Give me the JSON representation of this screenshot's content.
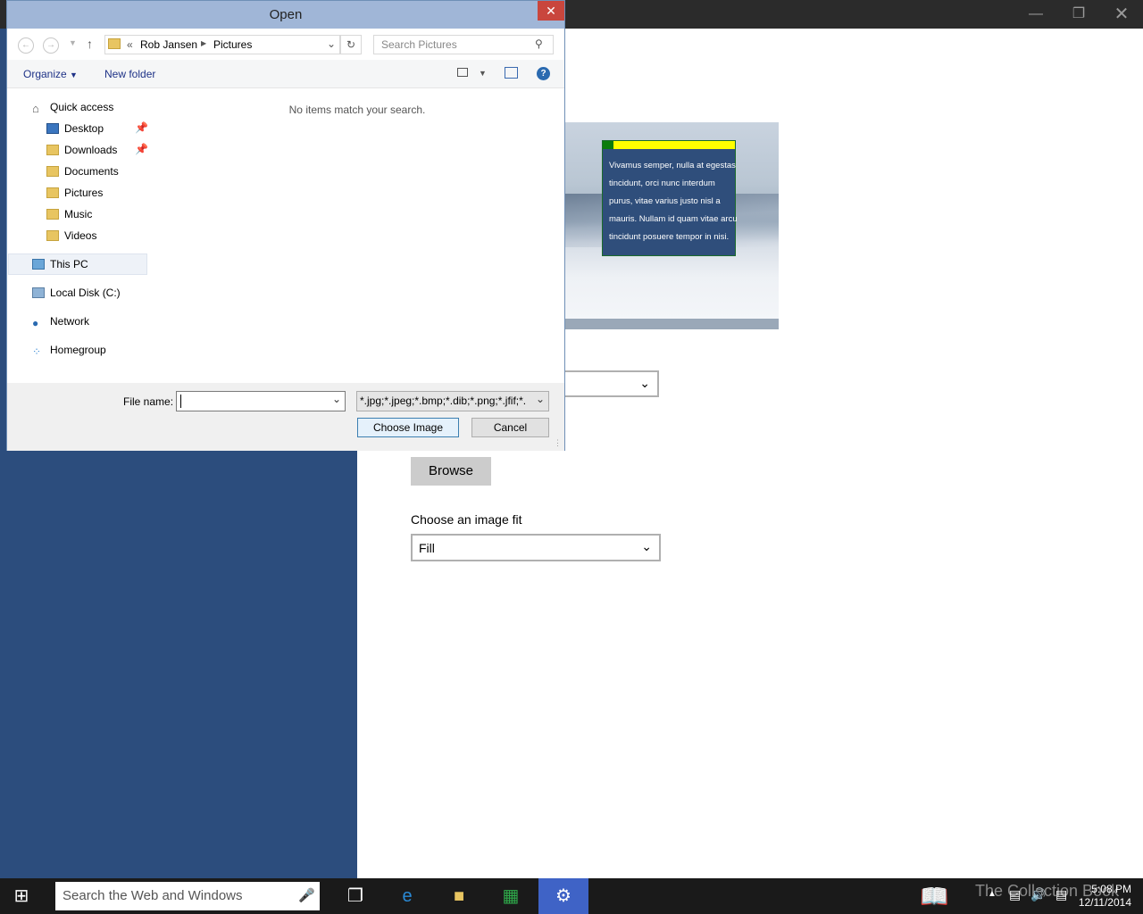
{
  "background_app": {
    "preview_tile_text": "Vivamus semper, nulla at egestas\ntincidunt, orci nunc interdum\npurus, vitae varius justo nisl a\nmauris. Nullam id quam vitae arcu\ntincidunt posuere tempor in nisi.",
    "browse_label": "Browse",
    "fit_label": "Choose an image fit",
    "fit_value": "Fill"
  },
  "dialog": {
    "title": "Open",
    "breadcrumb": {
      "overflow": "«",
      "items": [
        "Rob Jansen",
        "Pictures"
      ]
    },
    "search_placeholder": "Search Pictures",
    "toolbar": {
      "organize": "Organize",
      "new_folder": "New folder"
    },
    "empty_message": "No items match your search.",
    "nav": {
      "quick_access": "Quick access",
      "quick_items": [
        "Desktop",
        "Downloads",
        "Documents",
        "Pictures",
        "Music",
        "Videos"
      ],
      "this_pc": "This PC",
      "local_disk": "Local Disk (C:)",
      "network": "Network",
      "homegroup": "Homegroup"
    },
    "file_name_label": "File name:",
    "file_name_value": "",
    "file_type": "*.jpg;*.jpeg;*.bmp;*.dib;*.png;*.jfif;*.",
    "choose_label": "Choose Image",
    "cancel_label": "Cancel"
  },
  "taskbar": {
    "search_placeholder": "Search the Web and Windows",
    "watermark": "The Collection Book",
    "time": "5:08 PM",
    "date": "12/11/2014"
  },
  "colors": {
    "accent": "#2c4d7d",
    "dialog_title": "#a0b6d7",
    "close_button": "#c9463d"
  }
}
